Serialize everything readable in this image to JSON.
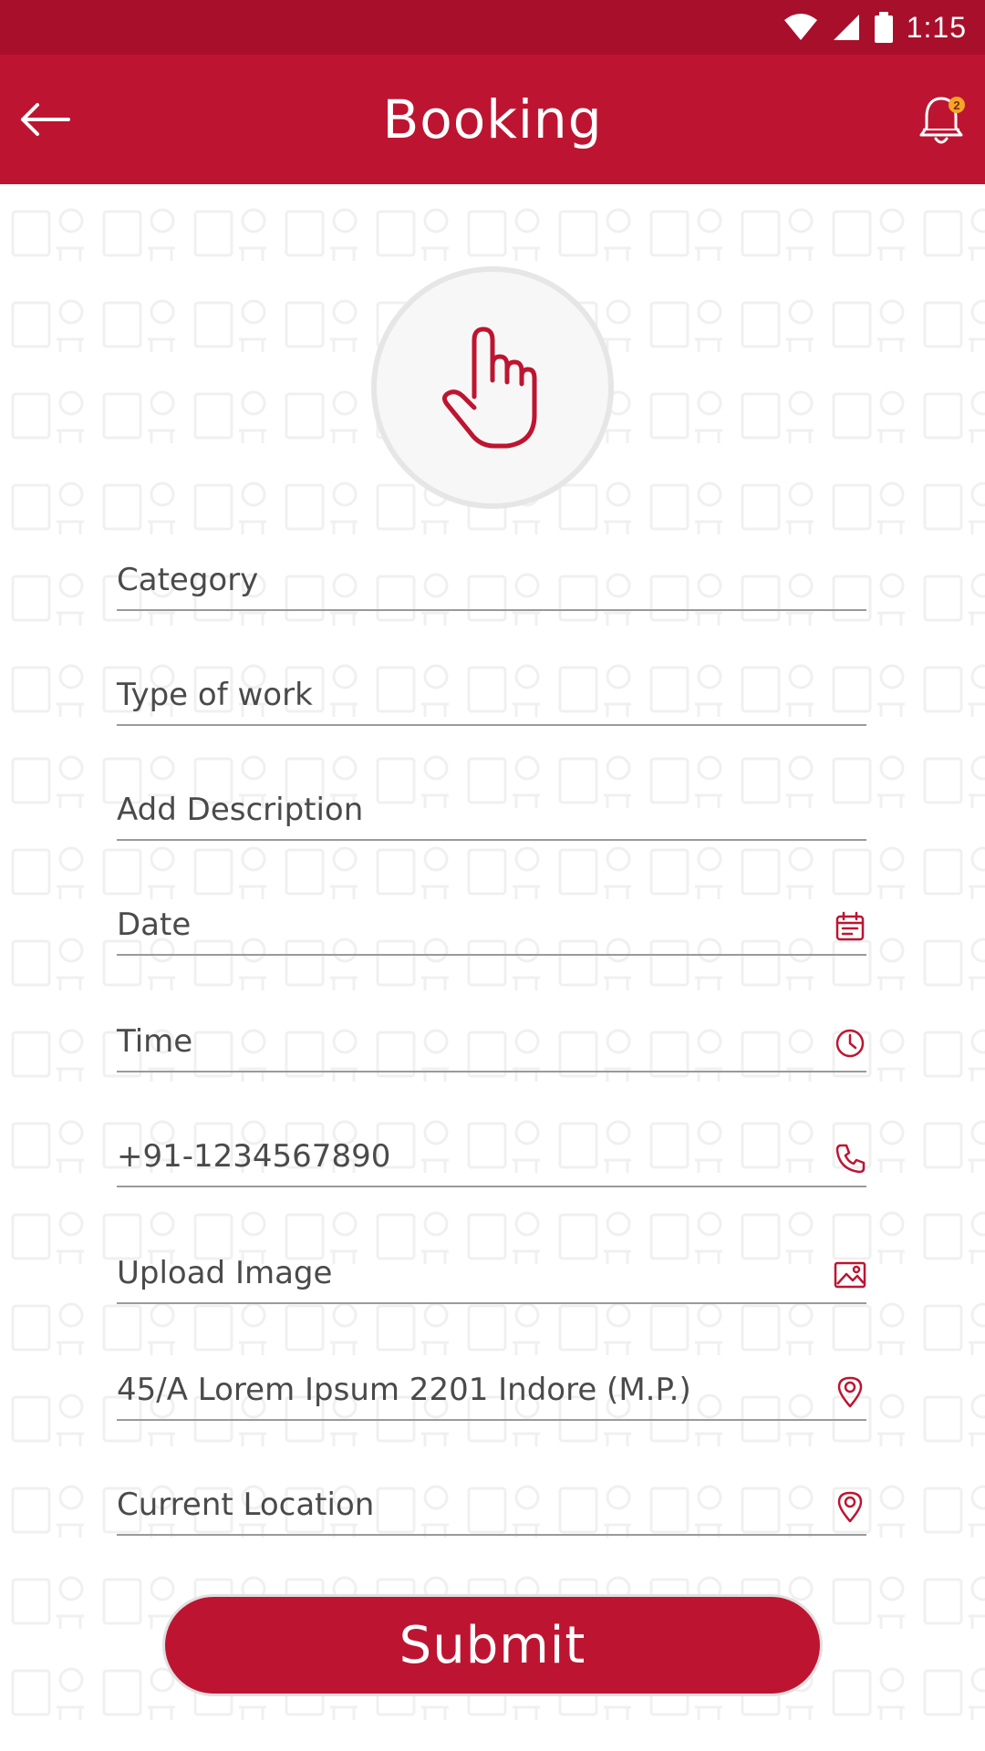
{
  "status_bar": {
    "time": "1:15"
  },
  "app_bar": {
    "title": "Booking",
    "notification_count": "2"
  },
  "form": {
    "fields": [
      {
        "key": "category",
        "placeholder": "Category",
        "icon": ""
      },
      {
        "key": "type_of_work",
        "placeholder": "Type of work",
        "icon": ""
      },
      {
        "key": "description",
        "placeholder": "Add Description",
        "icon": ""
      },
      {
        "key": "date",
        "placeholder": "Date",
        "icon": "calendar-icon"
      },
      {
        "key": "time",
        "placeholder": "Time",
        "icon": "clock-icon"
      },
      {
        "key": "phone",
        "value": "+91-1234567890",
        "icon": "phone-icon"
      },
      {
        "key": "upload_image",
        "placeholder": "Upload Image",
        "icon": "image-icon"
      },
      {
        "key": "address",
        "value": "45/A Lorem Ipsum 2201 Indore (M.P.)",
        "icon": "location-pin-icon"
      },
      {
        "key": "current_location",
        "placeholder": "Current Location",
        "icon": "location-pin-icon"
      }
    ],
    "submit_label": "Submit"
  },
  "colors": {
    "status_bar": "#a80f2b",
    "app_bar": "#bd1531",
    "accent": "#bd1531",
    "badge": "#f6a623"
  }
}
